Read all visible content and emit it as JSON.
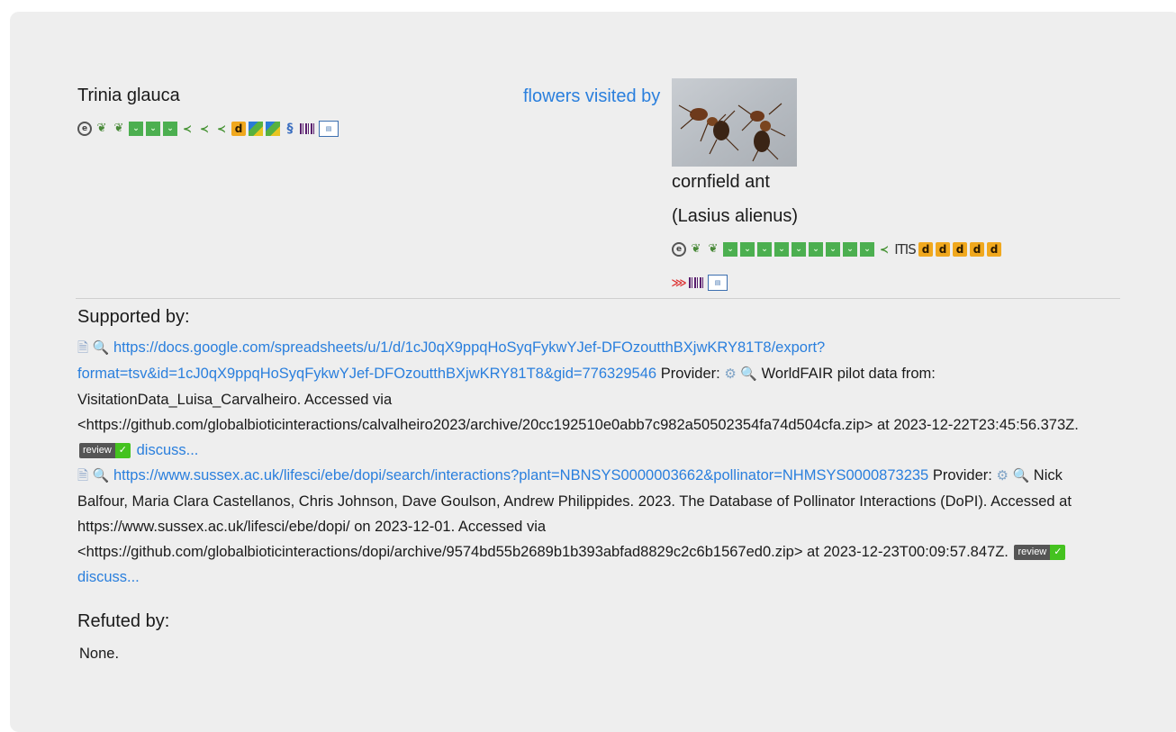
{
  "subject": {
    "name": "Trinia glauca",
    "icons": [
      "eol-icon",
      "gbif-icon",
      "gbif-icon",
      "inat-icon",
      "inat-icon",
      "inat-icon",
      "ncbi-icon",
      "ncbi-icon",
      "ncbi-icon",
      "discoverlife-icon",
      "bold-icon",
      "bold-icon",
      "wikidata-icon",
      "barcode-icon",
      "news-icon"
    ]
  },
  "interaction": {
    "label": "flowers visited by"
  },
  "target": {
    "common_name": "cornfield ant",
    "scientific_name": "(Lasius alienus)",
    "image_alt": "ants photo",
    "icons_row1": [
      "eol-icon",
      "gbif-icon",
      "gbif-icon",
      "inat-icon",
      "inat-icon",
      "inat-icon",
      "inat-icon",
      "inat-icon",
      "inat-icon",
      "inat-icon",
      "inat-icon",
      "inat-icon",
      "ncbi-icon",
      "itis-icon",
      "discoverlife-icon",
      "discoverlife-icon",
      "discoverlife-icon",
      "discoverlife-icon",
      "discoverlife-icon"
    ],
    "icons_row2": [
      "flybase-icon",
      "barcode-icon",
      "news-icon"
    ]
  },
  "supported_by": {
    "title": "Supported by:",
    "refs": [
      {
        "url": "https://docs.google.com/spreadsheets/u/1/d/1cJ0qX9ppqHoSyqFykwYJef-DFOzoutthBXjwKRY81T8/export?format=tsv&id=1cJ0qX9ppqHoSyqFykwYJef-DFOzoutthBXjwKRY81T8&gid=776329546",
        "provider_label": "Provider:",
        "citation": "WorldFAIR pilot data from: VisitationData_Luisa_Carvalheiro. Accessed via <https://github.com/globalbioticinteractions/calvalheiro2023/archive/20cc192510e0abb7c982a50502354fa74d504cfa.zip> at 2023-12-22T23:45:56.373Z.",
        "review": "review",
        "check": "✓",
        "discuss": "discuss..."
      },
      {
        "url": "https://www.sussex.ac.uk/lifesci/ebe/dopi/search/interactions?plant=NBNSYS0000003662&pollinator=NHMSYS0000873235",
        "provider_label": "Provider:",
        "citation": "Nick Balfour, Maria Clara Castellanos, Chris Johnson, Dave Goulson, Andrew Philippides. 2023. The Database of Pollinator Interactions (DoPI). Accessed at https://www.sussex.ac.uk/lifesci/ebe/dopi/ on 2023-12-01. Accessed via <https://github.com/globalbioticinteractions/dopi/archive/9574bd55b2689b1b393abfad8829c2c6b1567ed0.zip> at 2023-12-23T00:09:57.847Z.",
        "review": "review",
        "check": "✓",
        "discuss": "discuss..."
      }
    ]
  },
  "refuted_by": {
    "title": "Refuted by:",
    "none": "None."
  },
  "colors": {
    "link": "#2a7fdd",
    "background": "#eeeeee",
    "badge_green": "#44c21f"
  }
}
